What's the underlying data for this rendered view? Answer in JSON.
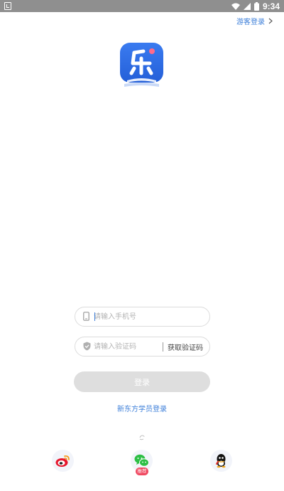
{
  "status_bar": {
    "time": "9:34",
    "icons": [
      "notification-icon",
      "wifi-icon",
      "cellular-signal-icon",
      "battery-icon"
    ]
  },
  "header": {
    "guest_login_label": "游客登录",
    "guest_login_icon": "chevron-right-icon"
  },
  "logo": {
    "icon": "app-logo-le",
    "brand_color": "#2f6fe6",
    "accent_color": "#ff6b8b"
  },
  "form": {
    "phone_placeholder": "请输入手机号",
    "phone_value": "",
    "phone_icon": "mobile-phone-icon",
    "code_placeholder": "请输入验证码",
    "code_value": "",
    "code_icon": "shield-icon",
    "get_code_label": "获取验证码",
    "login_label": "登录"
  },
  "member_login_label": "新东方学员登录",
  "social_login": {
    "items": [
      {
        "icon": "weibo-icon"
      },
      {
        "icon": "wechat-icon",
        "badge": "推荐"
      },
      {
        "icon": "qq-icon"
      }
    ]
  },
  "colors": {
    "link": "#3d7fd9",
    "button_disabled": "#dedede",
    "badge": "#f04a62",
    "status_bar": "#8f8f8f"
  }
}
